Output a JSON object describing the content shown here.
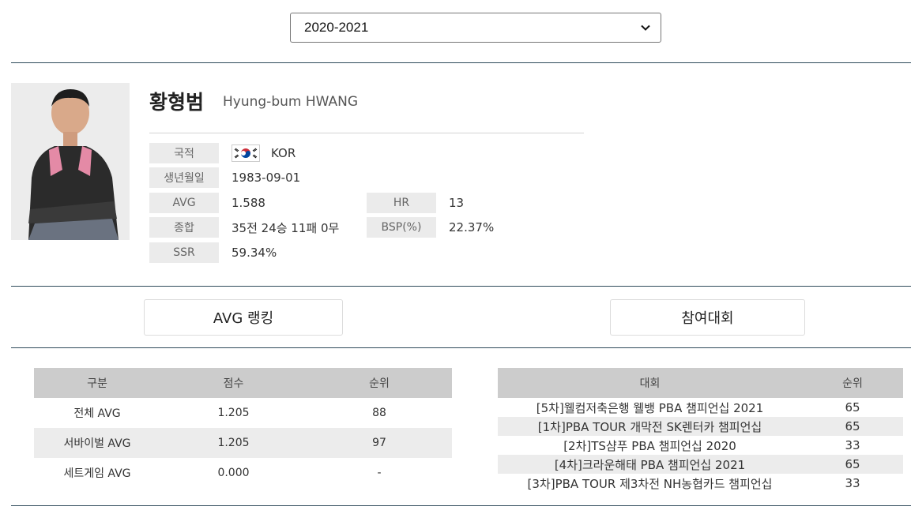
{
  "season": {
    "selected": "2020-2021"
  },
  "player": {
    "name_ko": "황형범",
    "name_en": "Hyung-bum HWANG",
    "nationality_label": "국적",
    "nationality": "KOR",
    "birth_label": "생년월일",
    "birth": "1983-09-01",
    "avg_label": "AVG",
    "avg": "1.588",
    "hr_label": "HR",
    "hr": "13",
    "record_label": "종합",
    "record": "35전 24승 11패 0무",
    "bsp_label": "BSP(%)",
    "bsp": "22.37%",
    "ssr_label": "SSR",
    "ssr": "59.34%"
  },
  "tabs": {
    "avg_ranking": "AVG 랭킹",
    "tournaments": "참여대회"
  },
  "avg_table": {
    "headers": [
      "구분",
      "점수",
      "순위"
    ],
    "rows": [
      [
        "전체 AVG",
        "1.205",
        "88"
      ],
      [
        "서바이벌 AVG",
        "1.205",
        "97"
      ],
      [
        "세트게임 AVG",
        "0.000",
        "-"
      ]
    ]
  },
  "tournament_table": {
    "headers": [
      "대회",
      "순위"
    ],
    "rows": [
      [
        "[5차]웰컴저축은행 웰뱅 PBA 챔피언십 2021",
        "65"
      ],
      [
        "[1차]PBA TOUR 개막전 SK렌터카 챔피언십",
        "65"
      ],
      [
        "[2차]TS샴푸 PBA 챔피언십 2020",
        "33"
      ],
      [
        "[4차]크라운해태 PBA 챔피언십 2021",
        "65"
      ],
      [
        "[3차]PBA TOUR 제3차전 NH농협카드 챔피언십",
        "33"
      ]
    ]
  },
  "colors": {
    "rule": "#2e4a5a",
    "label_bg": "#ebebeb",
    "header_bg": "#cccccc",
    "alt_row": "#ececec"
  },
  "icons": {
    "select_arrow": "chevron-down-icon",
    "flag": "korea-flag-icon"
  }
}
